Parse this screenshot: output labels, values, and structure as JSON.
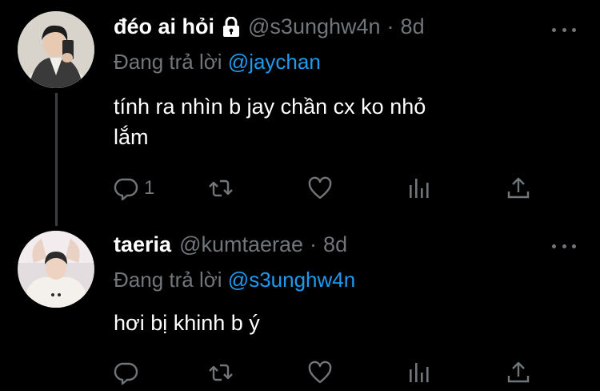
{
  "tweets": [
    {
      "display_name": "đéo ai hỏi",
      "locked": true,
      "handle": "@s3unghw4n",
      "separator": "·",
      "time": "8d",
      "replying_prefix": "Đang trả lời",
      "replying_to": "@jaychan",
      "text_line1": "tính ra nhìn b jay chần cx ko nhỏ",
      "text_line2": "lắm",
      "reply_count": "1",
      "avatar_icon": "user-photo-icon"
    },
    {
      "display_name": "taeria",
      "locked": false,
      "handle": "@kumtaerae",
      "separator": "·",
      "time": "8d",
      "replying_prefix": "Đang trả lời",
      "replying_to": "@s3unghw4n",
      "text_line1": "hơi bị khinh b ý",
      "reply_count": "",
      "avatar_icon": "user-photo-icon"
    }
  ],
  "colors": {
    "background": "#000000",
    "name": "#ffffff",
    "muted": "#71767b",
    "mention": "#1d9bf0",
    "thread_line": "#3a3f44"
  },
  "icons": [
    "lock-icon",
    "more-icon",
    "reply-icon",
    "retweet-icon",
    "like-icon",
    "analytics-icon",
    "share-icon"
  ]
}
